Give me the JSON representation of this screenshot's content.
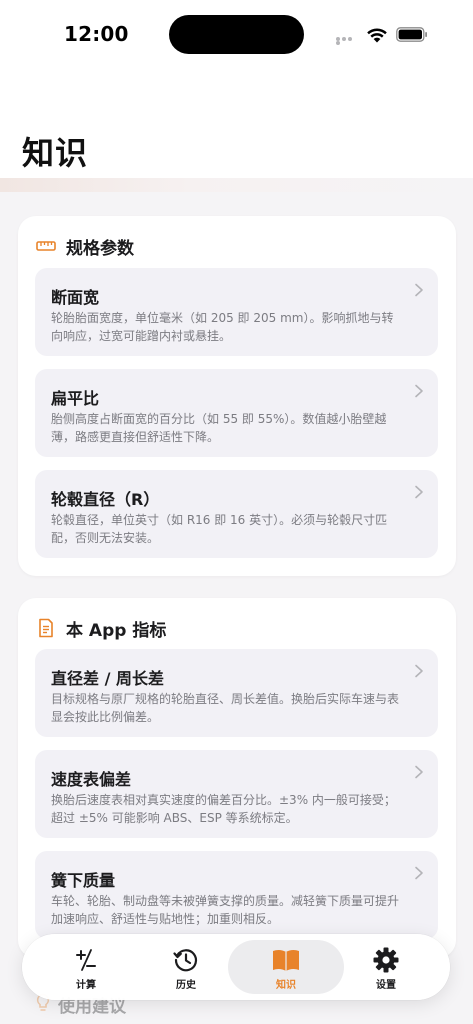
{
  "status_bar": {
    "time": "12:00"
  },
  "page": {
    "title": "知识"
  },
  "sections": [
    {
      "title": "规格参数",
      "icon": "ruler-icon",
      "items": [
        {
          "title": "断面宽",
          "desc": "轮胎胎面宽度，单位毫米（如 205 即 205 mm）。影响抓地与转向响应，过宽可能蹭内衬或悬挂。"
        },
        {
          "title": "扁平比",
          "desc": "胎侧高度占断面宽的百分比（如 55 即 55%）。数值越小胎壁越薄，路感更直接但舒适性下降。"
        },
        {
          "title": "轮毂直径（R）",
          "desc": "轮毂直径，单位英寸（如 R16 即 16 英寸）。必须与轮毂尺寸匹配，否则无法安装。"
        }
      ]
    },
    {
      "title": "本 App 指标",
      "icon": "document-icon",
      "items": [
        {
          "title": "直径差 / 周长差",
          "desc": "目标规格与原厂规格的轮胎直径、周长差值。换胎后实际车速与表显会按此比例偏差。"
        },
        {
          "title": "速度表偏差",
          "desc": "换胎后速度表相对真实速度的偏差百分比。±3% 内一般可接受；超过 ±5% 可能影响 ABS、ESP 等系统标定。"
        },
        {
          "title": "簧下质量",
          "desc": "车轮、轮胎、制动盘等未被弹簧支撑的质量。减轻簧下质量可提升加速响应、舒适性与贴地性；加重则相反。"
        }
      ]
    },
    {
      "title": "使用建议",
      "icon": "lightbulb-icon"
    }
  ],
  "tabs": [
    {
      "label": "计算",
      "icon": "plus-minus-icon"
    },
    {
      "label": "历史",
      "icon": "history-icon"
    },
    {
      "label": "知识",
      "icon": "book-icon",
      "active": true
    },
    {
      "label": "设置",
      "icon": "gear-icon"
    }
  ],
  "colors": {
    "accent": "#e8832a",
    "background": "#f5f4f6",
    "card": "#ffffff",
    "item": "#f2f1f6"
  }
}
